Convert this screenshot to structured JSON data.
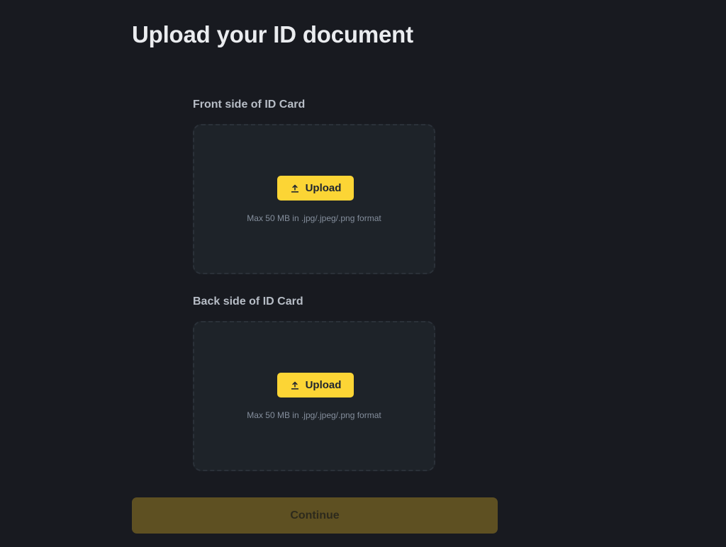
{
  "page": {
    "title": "Upload your ID document"
  },
  "front": {
    "label": "Front side of ID Card",
    "upload_label": "Upload",
    "hint": "Max 50 MB in .jpg/.jpeg/.png format"
  },
  "back": {
    "label": "Back side of ID Card",
    "upload_label": "Upload",
    "hint": "Max 50 MB in .jpg/.jpeg/.png format"
  },
  "footer": {
    "continue_label": "Continue",
    "continue_disabled": true
  },
  "icons": {
    "upload": "upload-arrow-icon"
  },
  "colors": {
    "background": "#181a20",
    "dropzone": "#1e2329",
    "accent": "#fcd535",
    "continue_disabled_bg": "#5e5022"
  }
}
